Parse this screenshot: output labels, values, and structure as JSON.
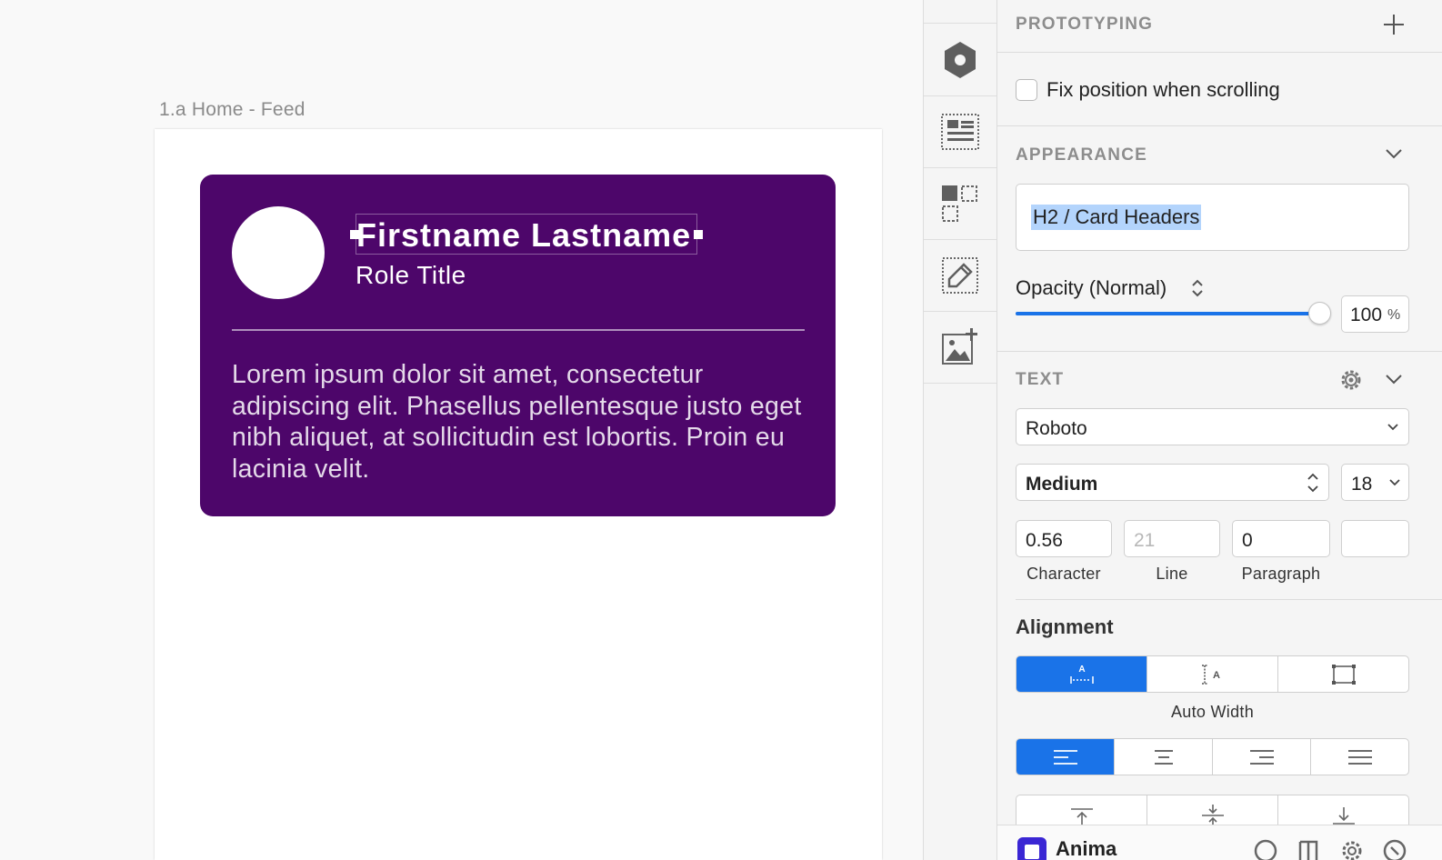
{
  "canvas": {
    "artboard_title": "1.a Home - Feed",
    "card": {
      "name": "Firstname Lastname",
      "role": "Role Title",
      "body": "Lorem ipsum dolor sit amet, consectetur adipiscing elit. Phasellus pellentesque justo eget nibh aliquet, at sollicitudin est lobortis. Proin eu lacinia velit.",
      "background": "#4d066a"
    }
  },
  "toolbar": {
    "tools": [
      "symbol-icon",
      "layout-icon",
      "group-select-icon",
      "edit-icon",
      "add-image-icon"
    ]
  },
  "inspector": {
    "prototyping": {
      "header": "PROTOTYPING",
      "fix_position_label": "Fix position when scrolling",
      "fix_position_checked": false
    },
    "appearance": {
      "header": "APPEARANCE",
      "style_name": "H2 / Card Headers",
      "opacity_label": "Opacity (Normal)",
      "opacity_value": "100",
      "opacity_unit": "%",
      "opacity_fraction": 1.0
    },
    "text": {
      "header": "TEXT",
      "font_family": "Roboto",
      "font_weight": "Medium",
      "font_size": "18",
      "character_value": "0.56",
      "line_placeholder": "21",
      "paragraph_value": "0",
      "character_label": "Character",
      "line_label": "Line",
      "paragraph_label": "Paragraph"
    },
    "alignment": {
      "title": "Alignment",
      "width_mode_label": "Auto Width",
      "width_modes": [
        "auto-width-icon",
        "auto-height-icon",
        "fixed-size-icon"
      ],
      "width_mode_selected": 0,
      "horizontal_selected": 0
    },
    "plugin": {
      "name": "Anima"
    },
    "accent_color": "#1a73e8"
  }
}
